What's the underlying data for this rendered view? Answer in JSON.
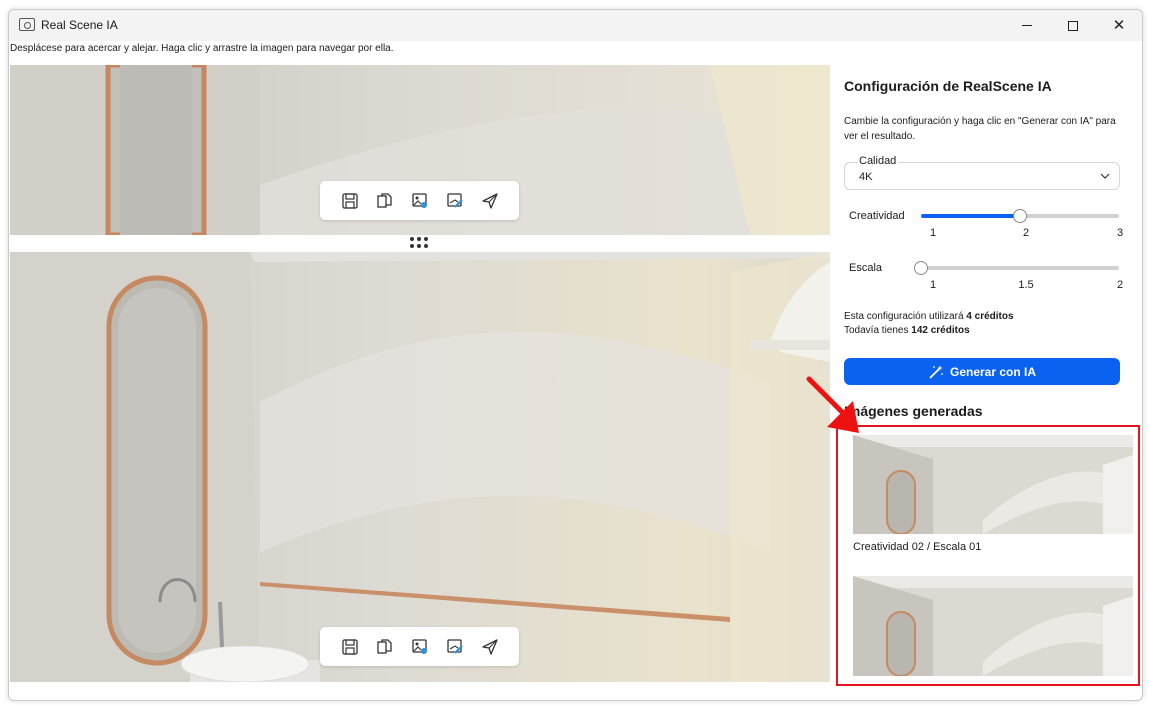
{
  "window": {
    "title": "Real Scene IA",
    "controls": [
      "minimize-icon",
      "maximize-icon",
      "close-icon"
    ]
  },
  "instructions": "Desplácese para acercar y alejar. Haga clic y arrastre la imagen para navegar por ella.",
  "toolbar": {
    "icons": [
      "save-icon",
      "copy-icon",
      "image-settings-icon",
      "edit-image-icon",
      "send-icon"
    ]
  },
  "panel": {
    "title": "Configuración de RealScene IA",
    "description": "Cambie la configuración y haga clic en \"Generar con IA\" para ver el resultado.",
    "quality": {
      "label": "Calidad",
      "value": "4K"
    },
    "creativity": {
      "label": "Creatividad",
      "min": 1,
      "max": 3,
      "value": 2,
      "ticks": [
        "1",
        "2",
        "3"
      ]
    },
    "scale": {
      "label": "Escala",
      "min": 1,
      "max": 2,
      "value": 1,
      "ticks": [
        "1",
        "1.5",
        "2"
      ]
    },
    "credits": {
      "line1_prefix": "Esta configuración utilizará ",
      "line1_value": "4 créditos",
      "line2_prefix": "Todavía tienes ",
      "line2_value": "142 créditos"
    },
    "generate_label": "Generar con IA",
    "generated_title": "Imágenes generadas",
    "generated": [
      {
        "caption": "Creatividad 02 / Escala 01"
      }
    ]
  },
  "colors": {
    "accent": "#0b62f0",
    "highlight": "#e2141c",
    "annotation_arrow": "#ee1111"
  }
}
